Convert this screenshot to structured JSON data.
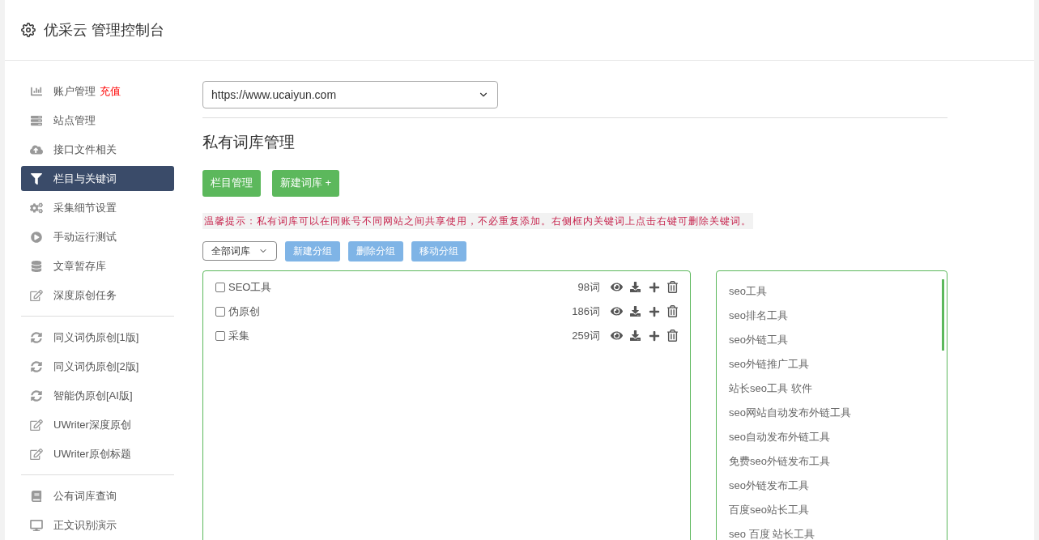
{
  "header": {
    "title": "优采云 管理控制台"
  },
  "sidebar": {
    "groups": [
      {
        "items": [
          {
            "label": "账户管理",
            "badge": "充值",
            "selected": false
          },
          {
            "label": "站点管理",
            "selected": false
          },
          {
            "label": "接口文件相关",
            "selected": false
          },
          {
            "label": "栏目与关键词",
            "selected": true
          },
          {
            "label": "采集细节设置",
            "selected": false
          },
          {
            "label": "手动运行测试",
            "selected": false
          },
          {
            "label": "文章暂存库",
            "selected": false
          },
          {
            "label": "深度原创任务",
            "selected": false
          }
        ]
      },
      {
        "items": [
          {
            "label": "同义词伪原创[1版]",
            "selected": false
          },
          {
            "label": "同义词伪原创[2版]",
            "selected": false
          },
          {
            "label": "智能伪原创[AI版]",
            "selected": false
          },
          {
            "label": "UWriter深度原创",
            "selected": false
          },
          {
            "label": "UWriter原创标题",
            "selected": false
          }
        ]
      },
      {
        "items": [
          {
            "label": "公有词库查询",
            "selected": false
          },
          {
            "label": "正文识别演示",
            "selected": false
          }
        ]
      }
    ]
  },
  "site_select": {
    "value": "https://www.ucaiyun.com"
  },
  "page_title": "私有词库管理",
  "top_buttons": [
    "栏目管理",
    "新建词库 +"
  ],
  "tip": "温馨提示：私有词库可以在同账号不同网站之间共享使用，不必重复添加。右侧框内关键词上点击右键可删除关键词。",
  "group_select": {
    "value": "全部词库"
  },
  "group_buttons": [
    "新建分组",
    "删除分组",
    "移动分组"
  ],
  "libraries": [
    {
      "name": "SEO工具",
      "count": "98词",
      "checked": false
    },
    {
      "name": "伪原创",
      "count": "186词",
      "checked": false
    },
    {
      "name": "采集",
      "count": "259词",
      "checked": false
    }
  ],
  "keywords": [
    "seo工具",
    "seo排名工具",
    "seo外链工具",
    "seo外链推广工具",
    "站长seo工具 软件",
    "seo网站自动发布外链工具",
    "seo自动发布外链工具",
    "免费seo外链发布工具",
    "seo外链发布工具",
    "百度seo站长工具",
    "seo 百度 站长工具"
  ]
}
